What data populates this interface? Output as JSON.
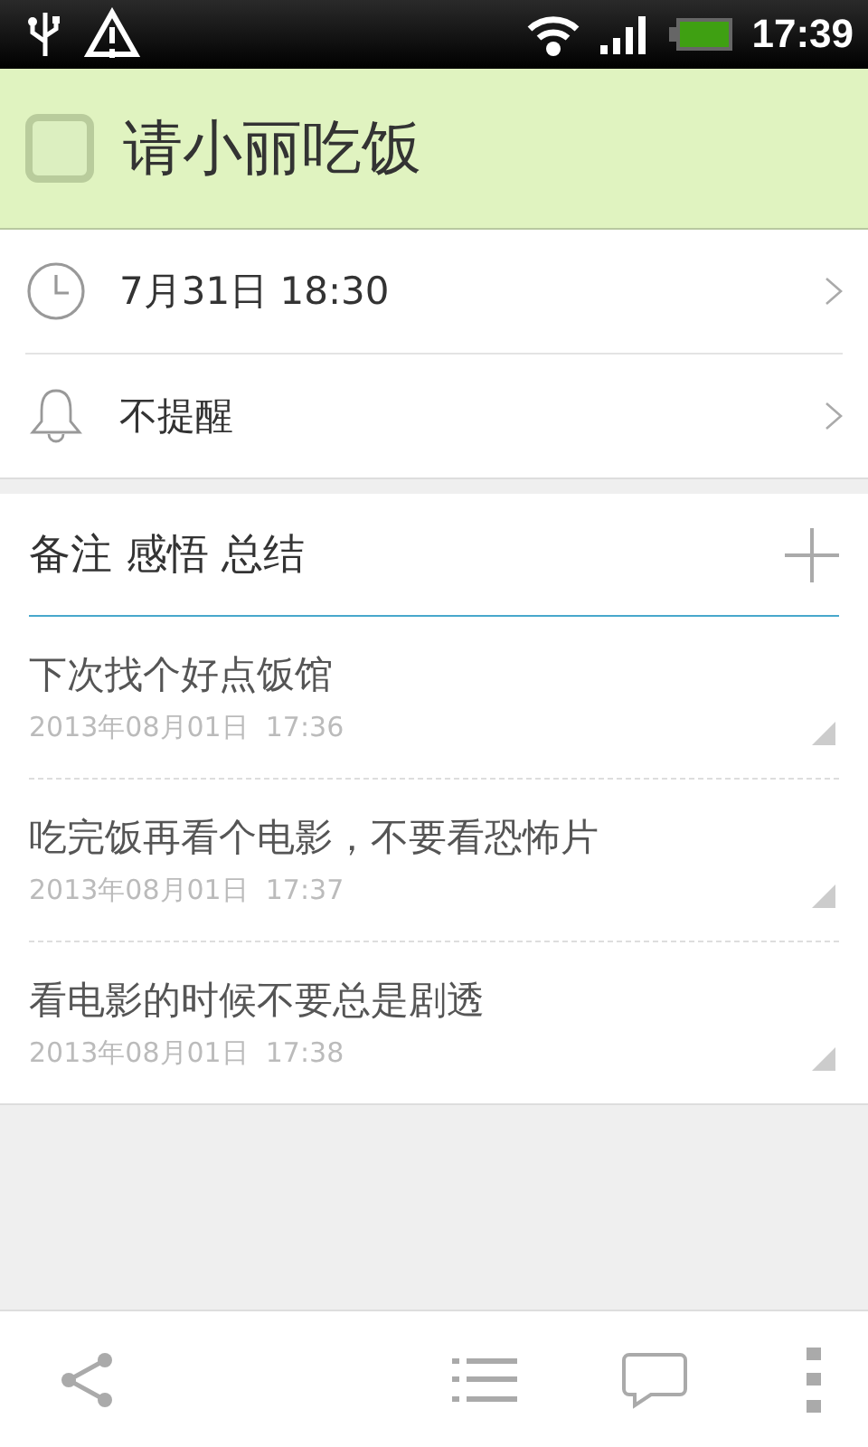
{
  "status_bar": {
    "time": "17:39"
  },
  "task": {
    "title": "请小丽吃饭",
    "checked": false
  },
  "details": [
    {
      "kind": "time",
      "text": "7月31日 18:30"
    },
    {
      "kind": "reminder",
      "text": "不提醒"
    }
  ],
  "notes_section": {
    "title": "备注 感悟 总结"
  },
  "notes": [
    {
      "text": "下次找个好点饭馆",
      "time": "2013年08月01日  17:36"
    },
    {
      "text": "吃完饭再看个电影，不要看恐怖片",
      "time": "2013年08月01日  17:37"
    },
    {
      "text": "看电影的时候不要总是剧透",
      "time": "2013年08月01日  17:38"
    }
  ]
}
